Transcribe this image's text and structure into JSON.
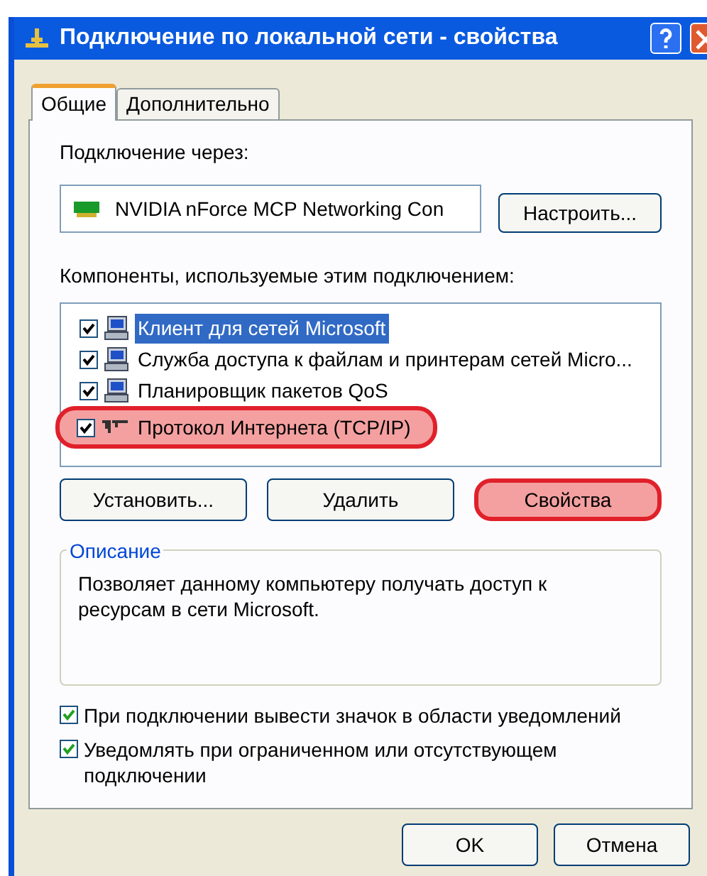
{
  "window": {
    "title": "Подключение по локальной сети - свойства"
  },
  "tabs": [
    {
      "label": "Общие",
      "selected": true
    },
    {
      "label": "Дополнительно",
      "selected": false
    }
  ],
  "connect_via": {
    "label": "Подключение через:",
    "adapter": "NVIDIA nForce MCP Networking Con",
    "button": "Настроить..."
  },
  "components": {
    "label": "Компоненты, используемые этим подключением:",
    "items": [
      {
        "kind": "client",
        "label": "Клиент для сетей Microsoft",
        "checked": true,
        "selected": true,
        "highlighted": false
      },
      {
        "kind": "service",
        "label": "Служба доступа к файлам и принтерам сетей Micro...",
        "checked": true,
        "selected": false,
        "highlighted": false
      },
      {
        "kind": "service",
        "label": "Планировщик пакетов QoS",
        "checked": true,
        "selected": false,
        "highlighted": false
      },
      {
        "kind": "protocol",
        "label": "Протокол Интернета (TCP/IP)",
        "checked": true,
        "selected": false,
        "highlighted": true
      }
    ]
  },
  "component_buttons": [
    {
      "label": "Установить...",
      "highlighted": false
    },
    {
      "label": "Удалить",
      "highlighted": false
    },
    {
      "label": "Свойства",
      "highlighted": true
    }
  ],
  "description": {
    "legend": "Описание",
    "text": "Позволяет данному компьютеру получать доступ к ресурсам в сети Microsoft."
  },
  "options": [
    {
      "label": "При подключении вывести значок в области уведомлений",
      "checked": true
    },
    {
      "label": "Уведомлять при ограниченном или отсутствующем подключении",
      "checked": true
    }
  ],
  "dialog_buttons": [
    "OK",
    "Отмена"
  ]
}
